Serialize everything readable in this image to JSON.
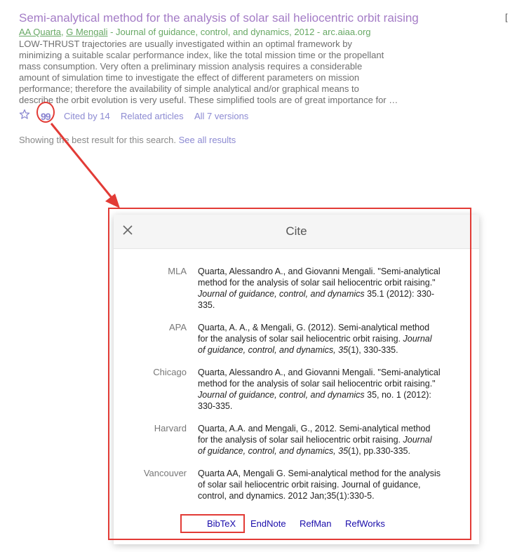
{
  "result": {
    "title": "Semi-analytical method for the analysis of solar sail heliocentric orbit raising",
    "author1": "AA Quarta",
    "author_sep": ", ",
    "author2": "G Mengali",
    "source": " - Journal of guidance, control, and dynamics, 2012 - arc.aiaa.org",
    "snippet_lines": [
      "LOW-THRUST trajectories are usually investigated within an optimal framework by",
      "minimizing a suitable scalar performance index, like the total mission time or the propellant",
      "mass consumption. Very often a preliminary mission analysis requires a considerable",
      "amount of simulation time to investigate the effect of different parameters on mission",
      "performance; therefore the availability of simple analytical and/or graphical means to",
      "describe the orbit evolution is very useful. These simplified tools are of great importance for …"
    ],
    "quote_glyph": "99",
    "cited_by": "Cited by 14",
    "related": "Related articles",
    "versions": "All 7 versions"
  },
  "best_result": {
    "text": "Showing the best result for this search. ",
    "link": "See all results"
  },
  "edge_mark": "[",
  "dialog": {
    "title": "Cite",
    "citations": [
      {
        "label": "MLA",
        "lines": [
          "Quarta, Alessandro A., and Giovanni Mengali. \"Semi-analytical",
          "method for the analysis of solar sail heliocentric orbit raising.\""
        ],
        "italic": "Journal of guidance, control, and dynamics",
        "after_italic": " 35.1 (2012): 330-",
        "last": "335."
      },
      {
        "label": "APA",
        "line1": "Quarta, A. A., & Mengali, G. (2012). Semi-analytical method",
        "line2_pre": "for the analysis of solar sail heliocentric orbit raising. ",
        "line2_it": "Journal",
        "line3_it": "of guidance, control, and dynamics, 35",
        "line3_post": "(1), 330-335."
      },
      {
        "label": "Chicago",
        "lines": [
          "Quarta, Alessandro A., and Giovanni Mengali. \"Semi-analytical",
          "method for the analysis of solar sail heliocentric orbit raising.\""
        ],
        "italic": "Journal of guidance, control, and dynamics",
        "after_italic": " 35, no. 1 (2012):",
        "last": "330-335."
      },
      {
        "label": "Harvard",
        "line1": "Quarta, A.A. and Mengali, G., 2012. Semi-analytical method",
        "line2_pre": "for the analysis of solar sail heliocentric orbit raising. ",
        "line2_it": "Journal",
        "line3_it": "of guidance, control, and dynamics, 35",
        "line3_post": "(1), pp.330-335."
      },
      {
        "label": "Vancouver",
        "lines": [
          "Quarta AA, Mengali G. Semi-analytical method for the analysis",
          "of solar sail heliocentric orbit raising. Journal of guidance,",
          "control, and dynamics. 2012 Jan;35(1):330-5."
        ]
      }
    ],
    "exports": [
      "BibTeX",
      "EndNote",
      "RefMan",
      "RefWorks"
    ]
  },
  "colors": {
    "title": "#a47cc6",
    "authors": "#67a864",
    "link": "#8c8ad2",
    "annotation": "#e23b36",
    "export_link": "#1a0dab"
  }
}
